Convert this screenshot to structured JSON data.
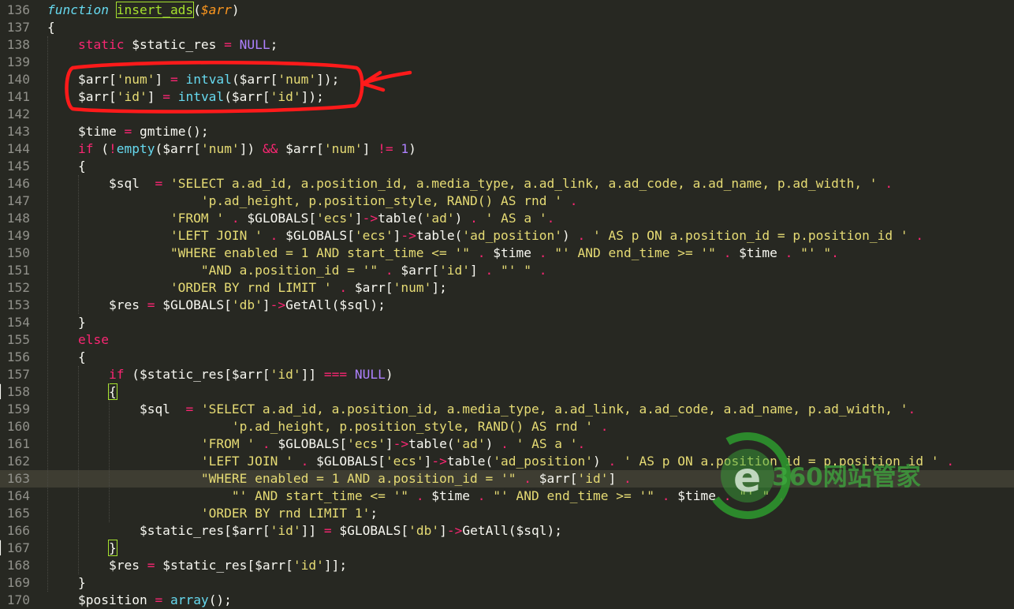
{
  "editor": {
    "theme_colors": {
      "background": "#272822",
      "keyword": "#F92672",
      "storage": "#66D9EF",
      "string": "#E6DB74",
      "number": "#AE81FF",
      "function_def": "#A6E22E",
      "parameter": "#FD971F",
      "line_number": "#90908A",
      "current_line": "#3E3D32"
    },
    "annotation_color": "#FF1A1A",
    "current_line": 163,
    "lines": [
      {
        "n": "136",
        "tokens": [
          [
            "sk",
            "function"
          ],
          [
            "pl",
            " "
          ],
          [
            "fndef",
            "insert_ads"
          ],
          [
            "pl",
            "("
          ],
          [
            "par",
            "$arr"
          ],
          [
            "pl",
            ")"
          ]
        ]
      },
      {
        "n": "137",
        "tokens": [
          [
            "pl",
            "{"
          ]
        ]
      },
      {
        "n": "138",
        "tokens": [
          [
            "pl",
            "    "
          ],
          [
            "kw",
            "static"
          ],
          [
            "pl",
            " $static_res "
          ],
          [
            "kw",
            "="
          ],
          [
            "pl",
            " "
          ],
          [
            "const",
            "NULL"
          ],
          [
            "pl",
            ";"
          ]
        ]
      },
      {
        "n": "139",
        "tokens": []
      },
      {
        "n": "140",
        "tokens": [
          [
            "pl",
            "    $arr["
          ],
          [
            "str",
            "'num'"
          ],
          [
            "pl",
            "] "
          ],
          [
            "kw",
            "="
          ],
          [
            "pl",
            " "
          ],
          [
            "fn",
            "intval"
          ],
          [
            "pl",
            "($arr["
          ],
          [
            "str",
            "'num'"
          ],
          [
            "pl",
            "]);"
          ]
        ]
      },
      {
        "n": "141",
        "tokens": [
          [
            "pl",
            "    $arr["
          ],
          [
            "str",
            "'id'"
          ],
          [
            "pl",
            "] "
          ],
          [
            "kw",
            "="
          ],
          [
            "pl",
            " "
          ],
          [
            "fn",
            "intval"
          ],
          [
            "pl",
            "($arr["
          ],
          [
            "str",
            "'id'"
          ],
          [
            "pl",
            "]);"
          ]
        ]
      },
      {
        "n": "142",
        "tokens": []
      },
      {
        "n": "143",
        "tokens": [
          [
            "pl",
            "    $time "
          ],
          [
            "kw",
            "="
          ],
          [
            "pl",
            " gmtime();"
          ]
        ]
      },
      {
        "n": "144",
        "tokens": [
          [
            "pl",
            "    "
          ],
          [
            "kw",
            "if"
          ],
          [
            "pl",
            " ("
          ],
          [
            "kw",
            "!"
          ],
          [
            "fn",
            "empty"
          ],
          [
            "pl",
            "($arr["
          ],
          [
            "str",
            "'num'"
          ],
          [
            "pl",
            "]) "
          ],
          [
            "kw",
            "&&"
          ],
          [
            "pl",
            " $arr["
          ],
          [
            "str",
            "'num'"
          ],
          [
            "pl",
            "] "
          ],
          [
            "kw",
            "!="
          ],
          [
            "pl",
            " "
          ],
          [
            "num",
            "1"
          ],
          [
            "pl",
            ")"
          ]
        ]
      },
      {
        "n": "145",
        "tokens": [
          [
            "pl",
            "    {"
          ]
        ]
      },
      {
        "n": "146",
        "tokens": [
          [
            "pl",
            "        $sql  "
          ],
          [
            "kw",
            "="
          ],
          [
            "pl",
            " "
          ],
          [
            "str",
            "'SELECT a.ad_id, a.position_id, a.media_type, a.ad_link, a.ad_code, a.ad_name, p.ad_width, '"
          ],
          [
            "pl",
            " "
          ],
          [
            "kw",
            "."
          ]
        ]
      },
      {
        "n": "147",
        "tokens": [
          [
            "pl",
            "                    "
          ],
          [
            "str",
            "'p.ad_height, p.position_style, RAND() AS rnd '"
          ],
          [
            "pl",
            " "
          ],
          [
            "kw",
            "."
          ]
        ]
      },
      {
        "n": "148",
        "tokens": [
          [
            "pl",
            "                "
          ],
          [
            "str",
            "'FROM '"
          ],
          [
            "pl",
            " "
          ],
          [
            "kw",
            "."
          ],
          [
            "pl",
            " $GLOBALS["
          ],
          [
            "str",
            "'ecs'"
          ],
          [
            "pl",
            "]"
          ],
          [
            "kw",
            "->"
          ],
          [
            "pl",
            "table("
          ],
          [
            "str",
            "'ad'"
          ],
          [
            "pl",
            ") "
          ],
          [
            "kw",
            "."
          ],
          [
            "pl",
            " "
          ],
          [
            "str",
            "' AS a '"
          ],
          [
            "kw",
            "."
          ]
        ]
      },
      {
        "n": "149",
        "tokens": [
          [
            "pl",
            "                "
          ],
          [
            "str",
            "'LEFT JOIN '"
          ],
          [
            "pl",
            " "
          ],
          [
            "kw",
            "."
          ],
          [
            "pl",
            " $GLOBALS["
          ],
          [
            "str",
            "'ecs'"
          ],
          [
            "pl",
            "]"
          ],
          [
            "kw",
            "->"
          ],
          [
            "pl",
            "table("
          ],
          [
            "str",
            "'ad_position'"
          ],
          [
            "pl",
            ") "
          ],
          [
            "kw",
            "."
          ],
          [
            "pl",
            " "
          ],
          [
            "str",
            "' AS p ON a.position_id = p.position_id '"
          ],
          [
            "pl",
            " "
          ],
          [
            "kw",
            "."
          ]
        ]
      },
      {
        "n": "150",
        "tokens": [
          [
            "pl",
            "                "
          ],
          [
            "str",
            "\"WHERE enabled = 1 AND start_time <= '\""
          ],
          [
            "pl",
            " "
          ],
          [
            "kw",
            "."
          ],
          [
            "pl",
            " $time "
          ],
          [
            "kw",
            "."
          ],
          [
            "pl",
            " "
          ],
          [
            "str",
            "\"' AND end_time >= '\""
          ],
          [
            "pl",
            " "
          ],
          [
            "kw",
            "."
          ],
          [
            "pl",
            " $time "
          ],
          [
            "kw",
            "."
          ],
          [
            "pl",
            " "
          ],
          [
            "str",
            "\"' \""
          ],
          [
            "kw",
            "."
          ]
        ]
      },
      {
        "n": "151",
        "tokens": [
          [
            "pl",
            "                    "
          ],
          [
            "str",
            "\"AND a.position_id = '\""
          ],
          [
            "pl",
            " "
          ],
          [
            "kw",
            "."
          ],
          [
            "pl",
            " $arr["
          ],
          [
            "str",
            "'id'"
          ],
          [
            "pl",
            "] "
          ],
          [
            "kw",
            "."
          ],
          [
            "pl",
            " "
          ],
          [
            "str",
            "\"' \""
          ],
          [
            "pl",
            " "
          ],
          [
            "kw",
            "."
          ]
        ]
      },
      {
        "n": "152",
        "tokens": [
          [
            "pl",
            "                "
          ],
          [
            "str",
            "'ORDER BY rnd LIMIT '"
          ],
          [
            "pl",
            " "
          ],
          [
            "kw",
            "."
          ],
          [
            "pl",
            " $arr["
          ],
          [
            "str",
            "'num'"
          ],
          [
            "pl",
            "];"
          ]
        ]
      },
      {
        "n": "153",
        "tokens": [
          [
            "pl",
            "        $res "
          ],
          [
            "kw",
            "="
          ],
          [
            "pl",
            " $GLOBALS["
          ],
          [
            "str",
            "'db'"
          ],
          [
            "pl",
            "]"
          ],
          [
            "kw",
            "->"
          ],
          [
            "pl",
            "GetAll($sql);"
          ]
        ]
      },
      {
        "n": "154",
        "tokens": [
          [
            "pl",
            "    }"
          ]
        ]
      },
      {
        "n": "155",
        "tokens": [
          [
            "pl",
            "    "
          ],
          [
            "kw",
            "else"
          ]
        ]
      },
      {
        "n": "156",
        "tokens": [
          [
            "pl",
            "    {"
          ]
        ]
      },
      {
        "n": "157",
        "tokens": [
          [
            "pl",
            "        "
          ],
          [
            "kw",
            "if"
          ],
          [
            "pl",
            " ($static_res[$arr["
          ],
          [
            "str",
            "'id'"
          ],
          [
            "pl",
            "]] "
          ],
          [
            "kw",
            "==="
          ],
          [
            "pl",
            " "
          ],
          [
            "const",
            "NULL"
          ],
          [
            "pl",
            ")"
          ]
        ]
      },
      {
        "n": "158",
        "tokens": [
          [
            "pl",
            "        "
          ],
          [
            "bm",
            "{"
          ]
        ]
      },
      {
        "n": "159",
        "tokens": [
          [
            "pl",
            "            $sql  "
          ],
          [
            "kw",
            "="
          ],
          [
            "pl",
            " "
          ],
          [
            "str",
            "'SELECT a.ad_id, a.position_id, a.media_type, a.ad_link, a.ad_code, a.ad_name, p.ad_width, '"
          ],
          [
            "kw",
            "."
          ]
        ]
      },
      {
        "n": "160",
        "tokens": [
          [
            "pl",
            "                        "
          ],
          [
            "str",
            "'p.ad_height, p.position_style, RAND() AS rnd '"
          ],
          [
            "pl",
            " "
          ],
          [
            "kw",
            "."
          ]
        ]
      },
      {
        "n": "161",
        "tokens": [
          [
            "pl",
            "                    "
          ],
          [
            "str",
            "'FROM '"
          ],
          [
            "pl",
            " "
          ],
          [
            "kw",
            "."
          ],
          [
            "pl",
            " $GLOBALS["
          ],
          [
            "str",
            "'ecs'"
          ],
          [
            "pl",
            "]"
          ],
          [
            "kw",
            "->"
          ],
          [
            "pl",
            "table("
          ],
          [
            "str",
            "'ad'"
          ],
          [
            "pl",
            ") "
          ],
          [
            "kw",
            "."
          ],
          [
            "pl",
            " "
          ],
          [
            "str",
            "' AS a '"
          ],
          [
            "kw",
            "."
          ]
        ]
      },
      {
        "n": "162",
        "tokens": [
          [
            "pl",
            "                    "
          ],
          [
            "str",
            "'LEFT JOIN '"
          ],
          [
            "pl",
            " "
          ],
          [
            "kw",
            "."
          ],
          [
            "pl",
            " $GLOBALS["
          ],
          [
            "str",
            "'ecs'"
          ],
          [
            "pl",
            "]"
          ],
          [
            "kw",
            "->"
          ],
          [
            "pl",
            "table("
          ],
          [
            "str",
            "'ad_position'"
          ],
          [
            "pl",
            ") "
          ],
          [
            "kw",
            "."
          ],
          [
            "pl",
            " "
          ],
          [
            "str",
            "' AS p ON a.position_id = p.position_id '"
          ],
          [
            "pl",
            " "
          ],
          [
            "kw",
            "."
          ]
        ]
      },
      {
        "n": "163",
        "tokens": [
          [
            "pl",
            "                    "
          ],
          [
            "str",
            "\"WHERE enabled = 1 AND a.position_id = '\""
          ],
          [
            "pl",
            " "
          ],
          [
            "kw",
            "."
          ],
          [
            "pl",
            " $arr["
          ],
          [
            "str",
            "'id'"
          ],
          [
            "pl",
            "] "
          ],
          [
            "kw",
            "."
          ]
        ]
      },
      {
        "n": "164",
        "tokens": [
          [
            "pl",
            "                        "
          ],
          [
            "str",
            "\"' AND start_time <= '\""
          ],
          [
            "pl",
            " "
          ],
          [
            "kw",
            "."
          ],
          [
            "pl",
            " $time "
          ],
          [
            "kw",
            "."
          ],
          [
            "pl",
            " "
          ],
          [
            "str",
            "\"' AND end_time >= '\""
          ],
          [
            "pl",
            " "
          ],
          [
            "kw",
            "."
          ],
          [
            "pl",
            " $time "
          ],
          [
            "kw",
            "."
          ],
          [
            "pl",
            " "
          ],
          [
            "str",
            "\"' \""
          ],
          [
            "pl",
            " "
          ],
          [
            "kw",
            "."
          ]
        ]
      },
      {
        "n": "165",
        "tokens": [
          [
            "pl",
            "                    "
          ],
          [
            "str",
            "'ORDER BY rnd LIMIT 1'"
          ],
          [
            "pl",
            ";"
          ]
        ]
      },
      {
        "n": "166",
        "tokens": [
          [
            "pl",
            "            $static_res[$arr["
          ],
          [
            "str",
            "'id'"
          ],
          [
            "pl",
            "]] "
          ],
          [
            "kw",
            "="
          ],
          [
            "pl",
            " $GLOBALS["
          ],
          [
            "str",
            "'db'"
          ],
          [
            "pl",
            "]"
          ],
          [
            "kw",
            "->"
          ],
          [
            "pl",
            "GetAll($sql);"
          ]
        ]
      },
      {
        "n": "167",
        "tokens": [
          [
            "pl",
            "        "
          ],
          [
            "bm",
            "}"
          ]
        ]
      },
      {
        "n": "168",
        "tokens": [
          [
            "pl",
            "        $res "
          ],
          [
            "kw",
            "="
          ],
          [
            "pl",
            " $static_res[$arr["
          ],
          [
            "str",
            "'id'"
          ],
          [
            "pl",
            "]];"
          ]
        ]
      },
      {
        "n": "169",
        "tokens": [
          [
            "pl",
            "    }"
          ]
        ]
      },
      {
        "n": "170",
        "tokens": [
          [
            "pl",
            "    $position "
          ],
          [
            "kw",
            "="
          ],
          [
            "pl",
            " "
          ],
          [
            "fn",
            "array"
          ],
          [
            "pl",
            "();"
          ]
        ]
      }
    ]
  },
  "watermark": {
    "text": "360网站管家"
  }
}
